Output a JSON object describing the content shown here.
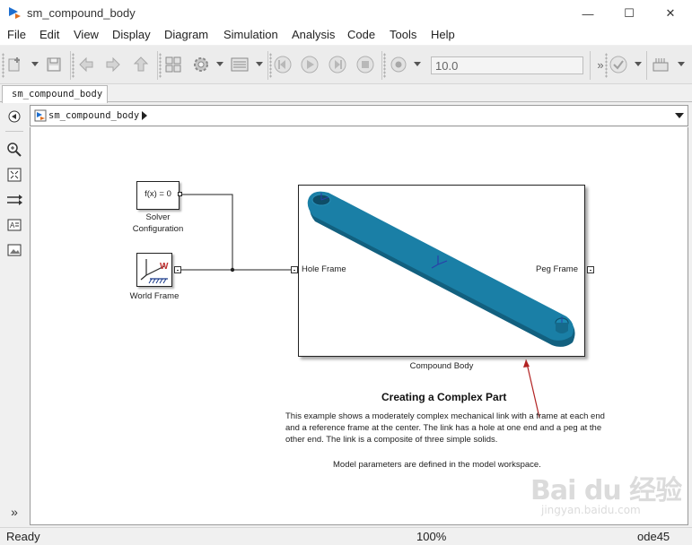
{
  "window": {
    "title": "sm_compound_body",
    "minimize_glyph": "—",
    "maximize_glyph": "☐",
    "close_glyph": "✕"
  },
  "menu": {
    "file": "File",
    "edit": "Edit",
    "view": "View",
    "display": "Display",
    "diagram": "Diagram",
    "simulation": "Simulation",
    "analysis": "Analysis",
    "code": "Code",
    "tools": "Tools",
    "help": "Help"
  },
  "toolbar": {
    "stop_time": "10.0",
    "overflow_glyph": "»"
  },
  "tab": {
    "label": "sm_compound_body"
  },
  "address": {
    "path": "sm_compound_body"
  },
  "palette": {
    "expand_glyph": "»"
  },
  "diagram": {
    "solver_block_text": "f(x) = 0",
    "solver_label_line1": "Solver",
    "solver_label_line2": "Configuration",
    "world_label": "World Frame",
    "world_icon_letter": "W",
    "compound_label": "Compound Body",
    "hole_frame": "Hole Frame",
    "peg_frame": "Peg Frame",
    "link_color": "#1a7fa6"
  },
  "description": {
    "heading": "Creating a Complex Part",
    "line1": "This example shows a moderately complex mechanical link with a frame at each end",
    "line2": "and a reference frame at the center. The link has a hole at one end and a peg at the",
    "line3": "other end. The link is a composite of three simple solids.",
    "params": "Model parameters are defined in the model workspace."
  },
  "status": {
    "ready": "Ready",
    "zoom": "100%",
    "solver": "ode45"
  },
  "watermark": {
    "logo": "Bai du 经验",
    "url": "jingyan.baidu.com"
  },
  "colors": {
    "accent_blue": "#1a7fa6",
    "annotation_red": "#b22222"
  }
}
